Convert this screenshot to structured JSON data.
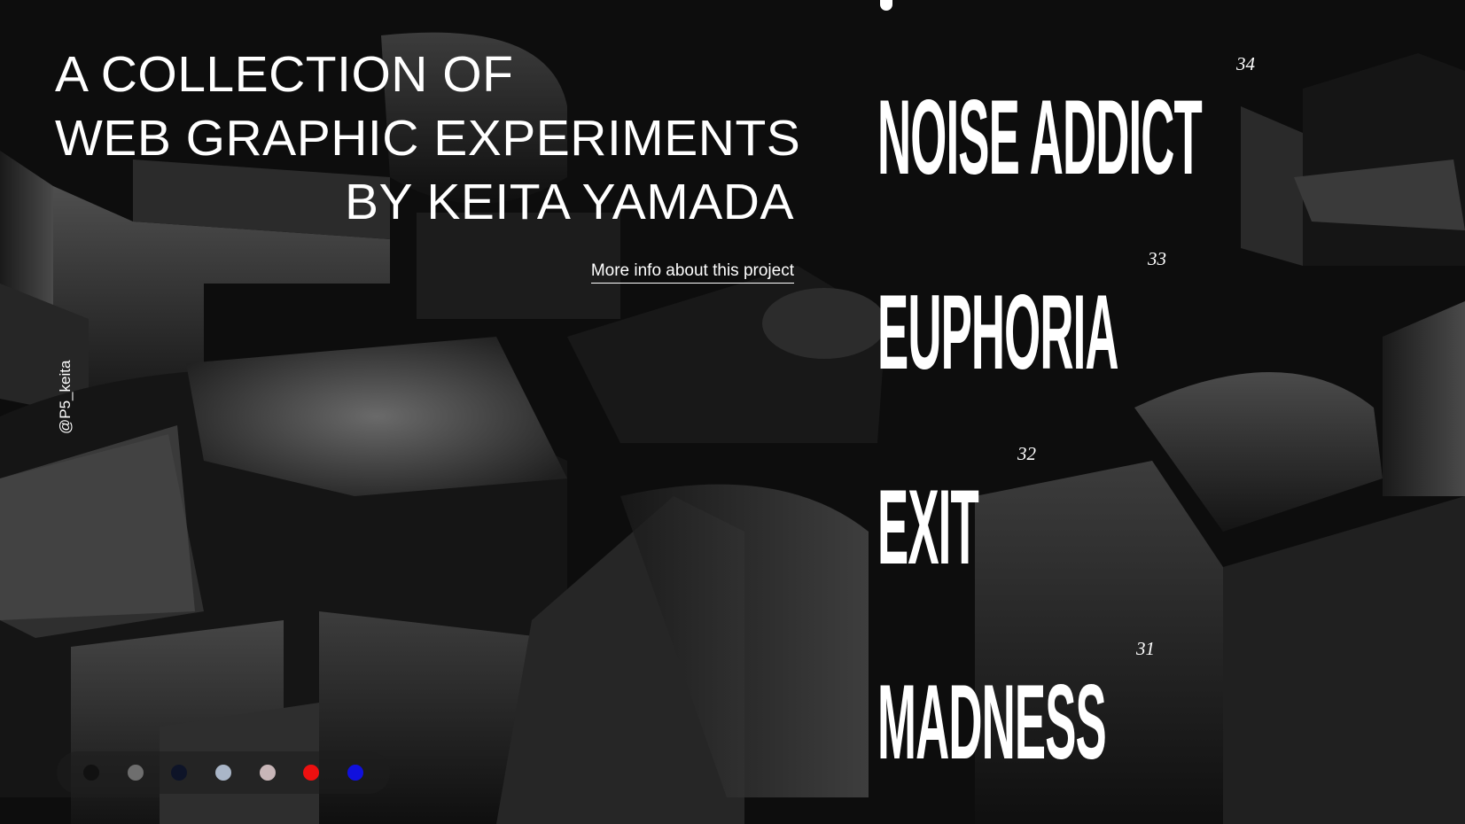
{
  "header": {
    "title_lines": [
      "A COLLECTION OF",
      "WEB GRAPHIC EXPERIMENTS",
      "BY KEITA YAMADA"
    ],
    "more_info_label": "More info about this project"
  },
  "social": {
    "handle": "@P5_keita"
  },
  "swatches": [
    {
      "color": "#111111"
    },
    {
      "color": "#6e6e6e"
    },
    {
      "color": "#0e1428"
    },
    {
      "color": "#aab6c8"
    },
    {
      "color": "#c8b6b8"
    },
    {
      "color": "#ee1010"
    },
    {
      "color": "#1010dd"
    }
  ],
  "projects": [
    {
      "name": "NOISE ADDICT",
      "number": "34"
    },
    {
      "name": "EUPHORIA",
      "number": "33"
    },
    {
      "name": "EXIT",
      "number": "32"
    },
    {
      "name": "MADNESS",
      "number": "31"
    }
  ]
}
